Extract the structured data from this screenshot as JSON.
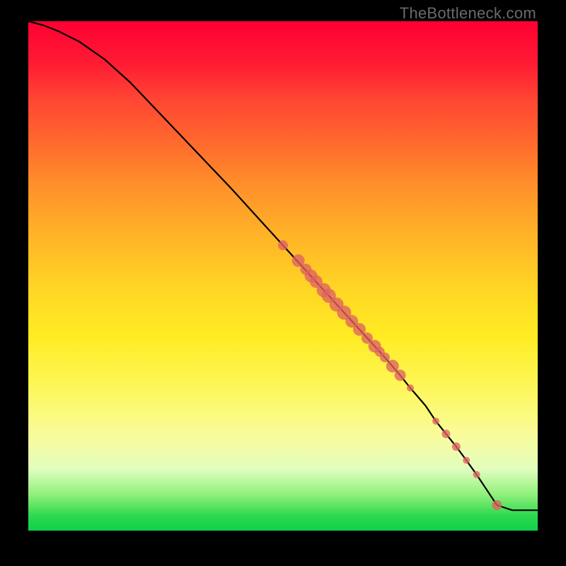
{
  "watermark": "TheBottleneck.com",
  "chart_data": {
    "type": "line",
    "title": "",
    "xlabel": "",
    "ylabel": "",
    "xlim": [
      0,
      100
    ],
    "ylim": [
      0,
      100
    ],
    "grid": false,
    "legend": false,
    "series": [
      {
        "name": "curve",
        "x": [
          0,
          3,
          6,
          10,
          15,
          20,
          30,
          40,
          45,
          50,
          55,
          57,
          60,
          63,
          65,
          68,
          70,
          73,
          75,
          78,
          80,
          82,
          84,
          86,
          88,
          90,
          92,
          95,
          100
        ],
        "y": [
          100,
          99.2,
          98,
          96,
          92.5,
          88,
          77.5,
          67,
          61.5,
          56,
          50.5,
          48.3,
          45,
          41.7,
          39.5,
          36.2,
          34,
          30.5,
          28,
          24.5,
          21.5,
          19,
          16.5,
          13.8,
          11,
          8,
          5,
          4,
          4
        ]
      }
    ],
    "scatter": [
      {
        "x": 50,
        "y": 56,
        "r": 7
      },
      {
        "x": 53,
        "y": 53,
        "r": 9
      },
      {
        "x": 54.5,
        "y": 51.3,
        "r": 8
      },
      {
        "x": 55.5,
        "y": 50,
        "r": 9
      },
      {
        "x": 56.5,
        "y": 48.9,
        "r": 9
      },
      {
        "x": 58,
        "y": 47.2,
        "r": 10
      },
      {
        "x": 59,
        "y": 46.1,
        "r": 10
      },
      {
        "x": 60.5,
        "y": 44.4,
        "r": 10
      },
      {
        "x": 62,
        "y": 42.8,
        "r": 10
      },
      {
        "x": 63.5,
        "y": 41.1,
        "r": 9
      },
      {
        "x": 65,
        "y": 39.5,
        "r": 9
      },
      {
        "x": 66.5,
        "y": 37.8,
        "r": 8
      },
      {
        "x": 68,
        "y": 36.2,
        "r": 9
      },
      {
        "x": 69,
        "y": 35.1,
        "r": 7
      },
      {
        "x": 70,
        "y": 34,
        "r": 7
      },
      {
        "x": 71.5,
        "y": 32.3,
        "r": 9
      },
      {
        "x": 73,
        "y": 30.5,
        "r": 8
      },
      {
        "x": 75,
        "y": 28,
        "r": 5
      },
      {
        "x": 80,
        "y": 21.5,
        "r": 5
      },
      {
        "x": 82,
        "y": 19,
        "r": 6
      },
      {
        "x": 84,
        "y": 16.5,
        "r": 6
      },
      {
        "x": 86,
        "y": 13.8,
        "r": 5
      },
      {
        "x": 88,
        "y": 11,
        "r": 5
      },
      {
        "x": 92,
        "y": 5,
        "r": 7
      }
    ],
    "colors": {
      "line": "#000000",
      "point_fill": "#e06262",
      "point_stroke": "#e06262"
    }
  }
}
